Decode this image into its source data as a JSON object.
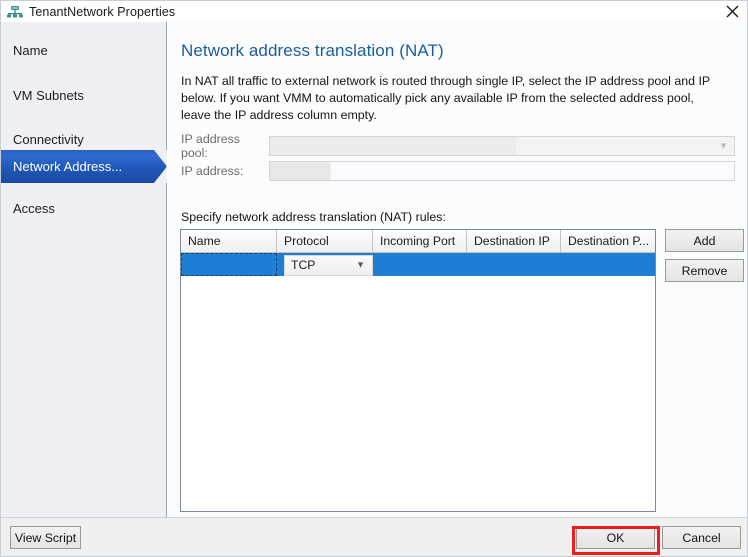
{
  "window": {
    "title": "TenantNetwork Properties",
    "icon": "network-node-icon",
    "close_icon": "close-icon",
    "accent_blue": "#1b5c9e",
    "selection_blue": "#1d7fd4",
    "highlight_red": "#ef1c1c"
  },
  "sidebar": {
    "items": [
      {
        "label": "Name",
        "selected": false,
        "name": "sidebar-item-name"
      },
      {
        "label": "VM Subnets",
        "selected": false,
        "name": "sidebar-item-vm-subnets"
      },
      {
        "label": "Connectivity",
        "selected": false,
        "name": "sidebar-item-connectivity"
      },
      {
        "label": "Network Address...",
        "selected": true,
        "name": "sidebar-item-network-address"
      },
      {
        "label": "Access",
        "selected": false,
        "name": "sidebar-item-access"
      }
    ]
  },
  "main": {
    "title": "Network address translation (NAT)",
    "description": "In NAT all traffic to external network is routed through single IP, select the IP address pool and IP below. If you want VMM to automatically pick any available IP from the selected address pool, leave the IP address column empty.",
    "fields": {
      "ip_address_pool": {
        "label": "IP address pool:",
        "value": "",
        "disabled": true,
        "chevron": "chevron-down-icon"
      },
      "ip_address": {
        "label": "IP address:",
        "value": "",
        "disabled": true
      }
    },
    "rules": {
      "label": "Specify network address translation (NAT) rules:",
      "columns": [
        "Name",
        "Protocol",
        "Incoming Port",
        "Destination IP",
        "Destination P..."
      ],
      "rows": [
        {
          "selected": true,
          "name_value": "",
          "protocol_value": "TCP",
          "incoming_port_value": "",
          "destination_ip_value": "",
          "destination_port_value": ""
        }
      ],
      "buttons": {
        "add": "Add",
        "remove": "Remove"
      }
    }
  },
  "footer": {
    "view_script": "View Script",
    "ok": "OK",
    "cancel": "Cancel"
  }
}
